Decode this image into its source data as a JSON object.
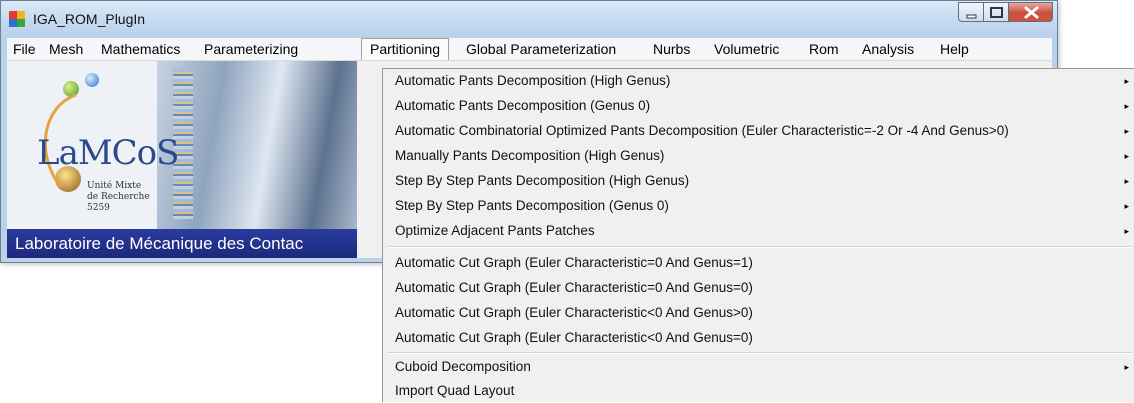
{
  "window": {
    "title": "IGA_ROM_PlugIn"
  },
  "menubar": {
    "items": [
      "File",
      "Mesh",
      "Mathematics",
      "Parameterizing",
      "Partitioning",
      "Global Parameterization",
      "Nurbs",
      "Volumetric",
      "Rom",
      "Analysis",
      "Help"
    ],
    "active": "Partitioning"
  },
  "banner": {
    "logo": "LaMCoS",
    "sub": [
      "Unité Mixte",
      "de Recherche",
      "5259"
    ],
    "strip": "Laboratoire de Mécanique des Contac"
  },
  "partitioning_menu": {
    "groups": [
      [
        {
          "label": "Automatic Pants Decomposition (High Genus)",
          "submenu": true
        },
        {
          "label": "Automatic Pants Decomposition (Genus 0)",
          "submenu": true
        },
        {
          "label": "Automatic Combinatorial Optimized Pants Decomposition (Euler Characteristic=-2 Or -4 And Genus>0)",
          "submenu": true
        },
        {
          "label": "Manually Pants Decomposition (High Genus)",
          "submenu": true
        },
        {
          "label": "Step By Step Pants Decomposition (High Genus)",
          "submenu": true
        },
        {
          "label": "Step By Step Pants Decomposition (Genus 0)",
          "submenu": true
        },
        {
          "label": "Optimize Adjacent Pants Patches",
          "submenu": true
        }
      ],
      [
        {
          "label": "Automatic Cut Graph (Euler Characteristic=0 And Genus=1)",
          "submenu": false
        },
        {
          "label": "Automatic Cut Graph (Euler Characteristic=0 And Genus=0)",
          "submenu": false
        },
        {
          "label": "Automatic Cut Graph (Euler Characteristic<0 And Genus>0)",
          "submenu": false
        },
        {
          "label": "Automatic Cut Graph (Euler Characteristic<0 And Genus=0)",
          "submenu": false
        }
      ],
      [
        {
          "label": "Cuboid Decomposition",
          "submenu": true
        },
        {
          "label": "Import Quad Layout",
          "submenu": false
        }
      ]
    ],
    "submenu_arrow": "▸"
  }
}
